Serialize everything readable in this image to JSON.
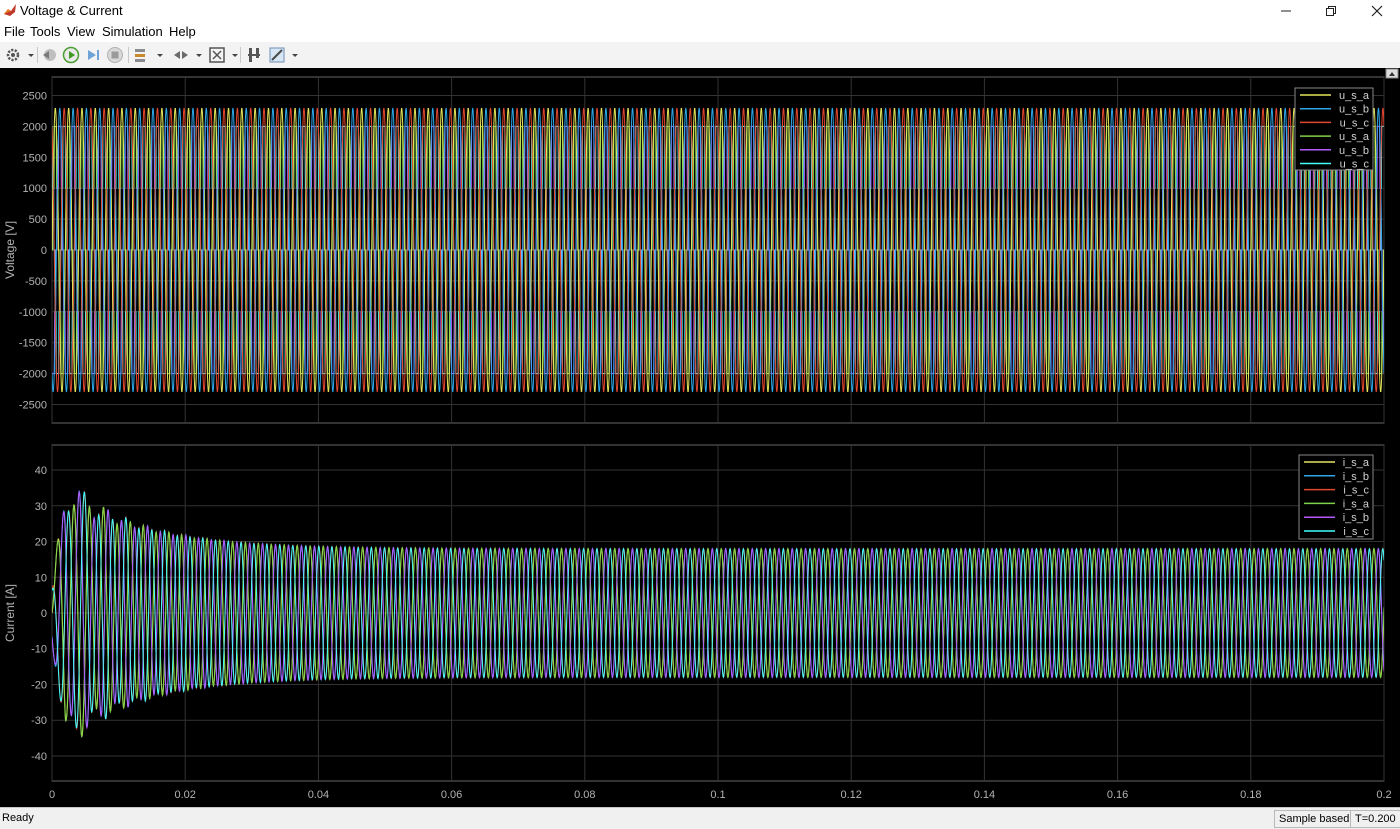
{
  "window": {
    "title": "Voltage & Current"
  },
  "menu": [
    "File",
    "Tools",
    "View",
    "Simulation",
    "Help"
  ],
  "status": {
    "text": "Ready",
    "mode": "Sample based",
    "time": "T=0.200"
  },
  "colors": {
    "background": "#000000",
    "grid": "#333333",
    "axis_text": "#b3b3b3",
    "series": [
      "#e5e55a",
      "#2ea7e8",
      "#e2462f",
      "#7fd14a",
      "#b35bff",
      "#40ffff"
    ]
  },
  "xaxis": {
    "ticks": [
      "0",
      "0.02",
      "0.04",
      "0.06",
      "0.08",
      "0.1",
      "0.12",
      "0.14",
      "0.16",
      "0.18",
      "0.2"
    ],
    "range": [
      0,
      0.2
    ]
  },
  "chart_data": [
    {
      "type": "line",
      "ylabel": "Voltage [V]",
      "ylim": [
        -2800,
        2800
      ],
      "yticks": [
        2500,
        2000,
        1500,
        1000,
        500,
        0,
        -500,
        -1000,
        -1500,
        -2000,
        -2500
      ],
      "grid": true,
      "legend_position": "top-right",
      "series": [
        {
          "name": "u_s_a",
          "kind": "sine",
          "amplitude": 2300,
          "frequency_hz": 500,
          "phase_deg": 0
        },
        {
          "name": "u_s_b",
          "kind": "sine",
          "amplitude": 2300,
          "frequency_hz": 500,
          "phase_deg": -120
        },
        {
          "name": "u_s_c",
          "kind": "sine",
          "amplitude": 2300,
          "frequency_hz": 500,
          "phase_deg": 120
        },
        {
          "name": "u_s_a",
          "kind": "stepped",
          "levels": [
            -2000,
            -1000,
            0,
            1000,
            2000
          ],
          "frequency_hz": 500,
          "phase_deg": 0
        },
        {
          "name": "u_s_b",
          "kind": "stepped",
          "levels": [
            -2000,
            -1000,
            0,
            1000,
            2000
          ],
          "frequency_hz": 500,
          "phase_deg": -120
        },
        {
          "name": "u_s_c",
          "kind": "stepped",
          "levels": [
            -2000,
            -1000,
            0,
            1000,
            2000
          ],
          "frequency_hz": 500,
          "phase_deg": 120
        }
      ]
    },
    {
      "type": "line",
      "ylabel": "Current [A]",
      "ylim": [
        -47,
        47
      ],
      "yticks": [
        40,
        30,
        20,
        10,
        0,
        -10,
        -20,
        -30,
        -40
      ],
      "grid": true,
      "legend_position": "top-right",
      "series": [
        {
          "name": "i_s_a",
          "kind": "damped_sine",
          "steady_amplitude": 18,
          "peak_amplitude": 37,
          "frequency_hz": 500,
          "phase_deg": 0
        },
        {
          "name": "i_s_b",
          "kind": "damped_sine",
          "steady_amplitude": 18,
          "peak_amplitude": 37,
          "frequency_hz": 500,
          "phase_deg": -120
        },
        {
          "name": "i_s_c",
          "kind": "damped_sine",
          "steady_amplitude": 18,
          "peak_amplitude": 37,
          "frequency_hz": 500,
          "phase_deg": 120
        },
        {
          "name": "i_s_a",
          "kind": "damped_sine",
          "steady_amplitude": 18,
          "peak_amplitude": 37,
          "frequency_hz": 500,
          "phase_deg": 5
        },
        {
          "name": "i_s_b",
          "kind": "damped_sine",
          "steady_amplitude": 18,
          "peak_amplitude": 37,
          "frequency_hz": 500,
          "phase_deg": -115
        },
        {
          "name": "i_s_c",
          "kind": "damped_sine",
          "steady_amplitude": 18,
          "peak_amplitude": 37,
          "frequency_hz": 500,
          "phase_deg": 125
        }
      ]
    }
  ]
}
